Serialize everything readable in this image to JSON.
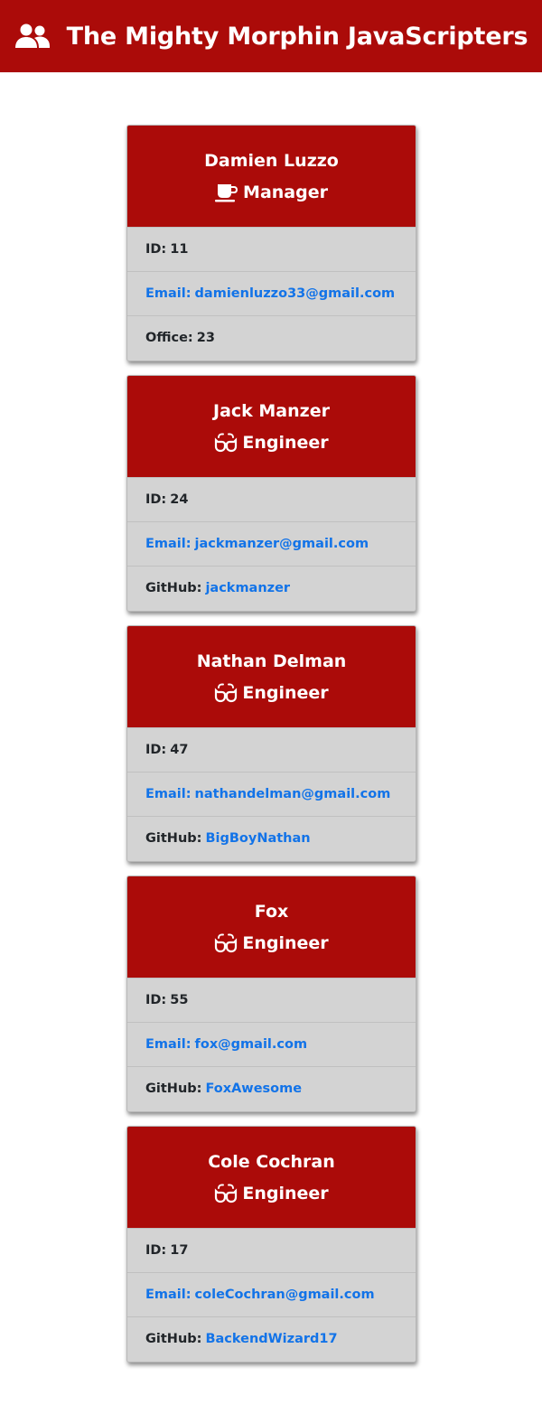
{
  "header": {
    "title": "The Mighty Morphin JavaScripters",
    "icon": "users-icon"
  },
  "colors": {
    "brand_red": "#ab0b09",
    "card_body": "#d3d3d3",
    "link_blue": "#1273e8"
  },
  "employees": [
    {
      "name": "Damien Luzzo",
      "role": "Manager",
      "role_icon": "coffee-mug-icon",
      "id_label": "ID:",
      "id": "11",
      "email_label": "Email:",
      "email": "damienluzzo33@gmail.com",
      "extra_label": "Office:",
      "extra": "23"
    },
    {
      "name": "Jack Manzer",
      "role": "Engineer",
      "role_icon": "glasses-icon",
      "id_label": "ID:",
      "id": "24",
      "email_label": "Email:",
      "email": "jackmanzer@gmail.com",
      "extra_label": "GitHub:",
      "extra": "jackmanzer"
    },
    {
      "name": "Nathan Delman",
      "role": "Engineer",
      "role_icon": "glasses-icon",
      "id_label": "ID:",
      "id": "47",
      "email_label": "Email:",
      "email": "nathandelman@gmail.com",
      "extra_label": "GitHub:",
      "extra": "BigBoyNathan"
    },
    {
      "name": "Fox",
      "role": "Engineer",
      "role_icon": "glasses-icon",
      "id_label": "ID:",
      "id": "55",
      "email_label": "Email:",
      "email": "fox@gmail.com",
      "extra_label": "GitHub:",
      "extra": "FoxAwesome"
    },
    {
      "name": "Cole Cochran",
      "role": "Engineer",
      "role_icon": "glasses-icon",
      "id_label": "ID:",
      "id": "17",
      "email_label": "Email:",
      "email": "coleCochran@gmail.com",
      "extra_label": "GitHub:",
      "extra": "BackendWizard17"
    }
  ]
}
